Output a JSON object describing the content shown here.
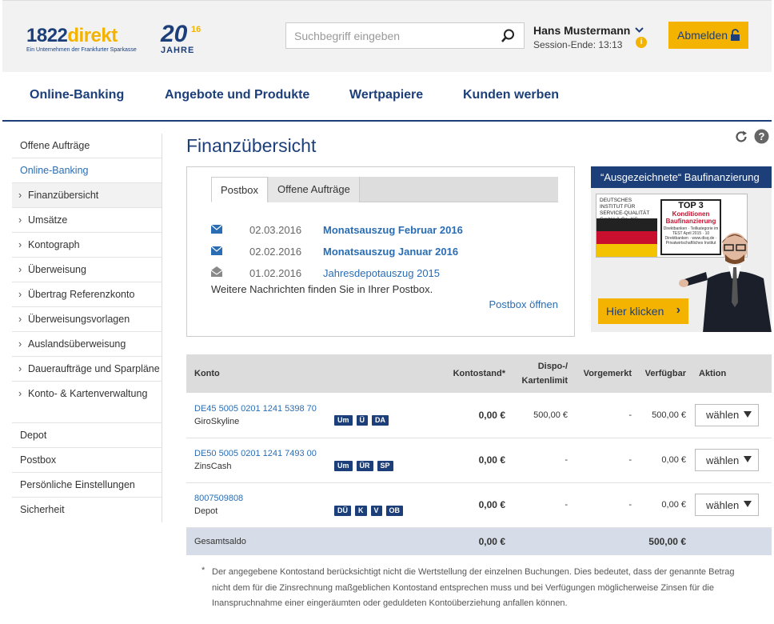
{
  "header": {
    "logo_num": "1822",
    "logo_txt": "direkt",
    "logo_sub": "Ein Unternehmen der Frankfurter Sparkasse",
    "jubilee_big": "20",
    "jubilee_sup": "16",
    "jubilee_label": "JAHRE",
    "search_placeholder": "Suchbegriff eingeben",
    "user_name": "Hans Mustermann",
    "session": "Session-Ende: 13:13",
    "logout_label": "Abmelden",
    "accent_color": "#f3b300",
    "brand_color": "#1c3f7a"
  },
  "mainnav": [
    "Online-Banking",
    "Angebote und Produkte",
    "Wertpapiere",
    "Kunden werben"
  ],
  "sidebar": [
    {
      "label": "Offene Aufträge",
      "level": 1
    },
    {
      "label": "Online-Banking",
      "level": 1,
      "active": true
    },
    {
      "label": "Finanzübersicht",
      "level": 2,
      "current": true
    },
    {
      "label": "Umsätze",
      "level": 2
    },
    {
      "label": "Kontograph",
      "level": 2
    },
    {
      "label": "Überweisung",
      "level": 2
    },
    {
      "label": "Übertrag Referenzkonto",
      "level": 2
    },
    {
      "label": "Überweisungsvorlagen",
      "level": 2
    },
    {
      "label": "Auslandsüberweisung",
      "level": 2
    },
    {
      "label": "Daueraufträge und Sparpläne",
      "level": 2
    },
    {
      "label": "Konto- & Kartenverwaltung",
      "level": 2
    },
    {
      "label": "Depot",
      "level": 1
    },
    {
      "label": "Postbox",
      "level": 1
    },
    {
      "label": "Persönliche Einstellungen",
      "level": 1
    },
    {
      "label": "Sicherheit",
      "level": 1
    }
  ],
  "page_title": "Finanzübersicht",
  "postbox": {
    "tab_active": "Postbox",
    "tab_other": "Offene Aufträge",
    "messages": [
      {
        "date": "02.03.2016",
        "title": "Monatsauszug Februar 2016",
        "unread": true
      },
      {
        "date": "02.02.2016",
        "title": "Monatsauszug Januar 2016",
        "unread": true
      },
      {
        "date": "01.02.2016",
        "title": "Jahresdepotauszug 2015",
        "unread": false
      }
    ],
    "more_text": "Weitere Nachrichten finden Sie in Ihrer Postbox.",
    "open_link": "Postbox öffnen"
  },
  "ad": {
    "title": "“Ausgezeichnete“ Baufinanzierung",
    "inst": "DEUTSCHES INSTITUT FÜR SERVICE-QUALITÄT GmbH & Co. KG",
    "seal_top": "TOP 3",
    "seal_kond": "Konditionen Baufinanzierung",
    "seal_small": "Direktbanken · Teilkategorie im TEST April 2015 · 10 Direktbanken · www.disq.de · Privatwirtschaftliches Institut",
    "button": "Hier klicken"
  },
  "table": {
    "headers": {
      "konto": "Konto",
      "kontostand": "Kontostand*",
      "dispo1": "Dispo-/",
      "dispo2": "Kartenlimit",
      "vorgemerkt": "Vorgemerkt",
      "verfuegbar": "Verfügbar",
      "aktion": "Aktion"
    },
    "rows": [
      {
        "iban": "DE45 5005 0201 1241 5398 70",
        "name": "GiroSkyline",
        "badges": [
          "Um",
          "Ü",
          "DA"
        ],
        "kontostand": "0,00 €",
        "dispo": "500,00 €",
        "vorgemerkt": "-",
        "verfuegbar": "500,00 €",
        "aktion": "wählen"
      },
      {
        "iban": "DE50 5005 0201 1241 7493 00",
        "name": "ZinsCash",
        "badges": [
          "Um",
          "ÜR",
          "SP"
        ],
        "kontostand": "0,00 €",
        "dispo": "-",
        "vorgemerkt": "-",
        "verfuegbar": "0,00 €",
        "aktion": "wählen"
      },
      {
        "iban": "8007509808",
        "name": "Depot",
        "badges": [
          "DÜ",
          "K",
          "V",
          "OB"
        ],
        "kontostand": "0,00 €",
        "dispo": "-",
        "vorgemerkt": "-",
        "verfuegbar": "0,00 €",
        "aktion": "wählen"
      }
    ],
    "total": {
      "label": "Gesamtsaldo",
      "kontostand": "0,00 €",
      "verfuegbar": "500,00 €"
    }
  },
  "footnote": {
    "star": "*",
    "text": "Der angegebene Kontostand berücksichtigt nicht die Wertstellung der einzelnen Buchungen. Dies bedeutet, dass der genannte Betrag nicht dem für die Zinsrechnung maßgeblichen Kontostand entsprechen muss und bei Verfügungen möglicherweise Zinsen für die Inanspruchnahme einer eingeräumten oder geduldeten Kontoüberziehung anfallen können."
  }
}
